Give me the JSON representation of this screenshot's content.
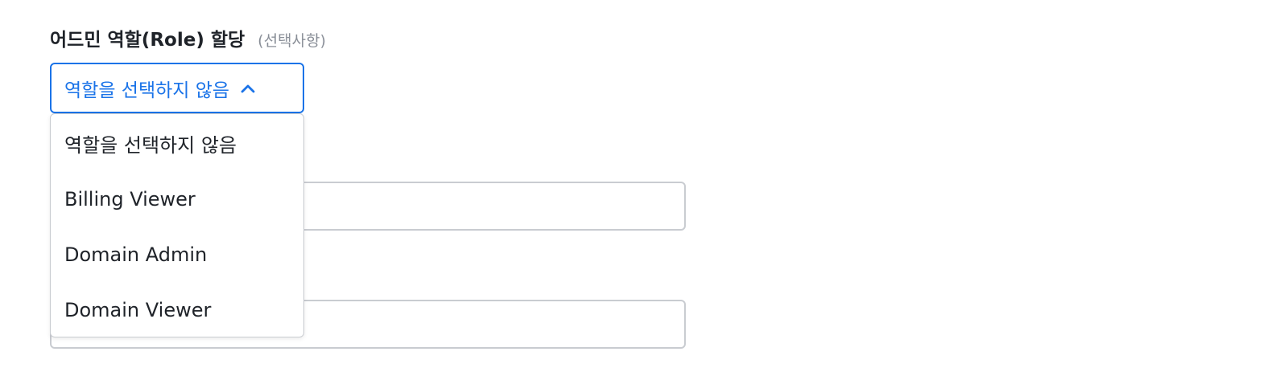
{
  "field": {
    "title": "어드민 역할(Role) 할당",
    "optional": "(선택사항)"
  },
  "select": {
    "value": "역할을 선택하지 않음",
    "expanded": true,
    "chevron_icon": "chevron-up-icon",
    "options": [
      {
        "label": "역할을 선택하지 않음"
      },
      {
        "label": "Billing Viewer"
      },
      {
        "label": "Domain Admin"
      },
      {
        "label": "Domain Viewer"
      }
    ]
  },
  "colors": {
    "accent": "#1a73e8",
    "text": "#1f2329",
    "muted": "#8a8f98",
    "border": "#c9ccd1"
  }
}
